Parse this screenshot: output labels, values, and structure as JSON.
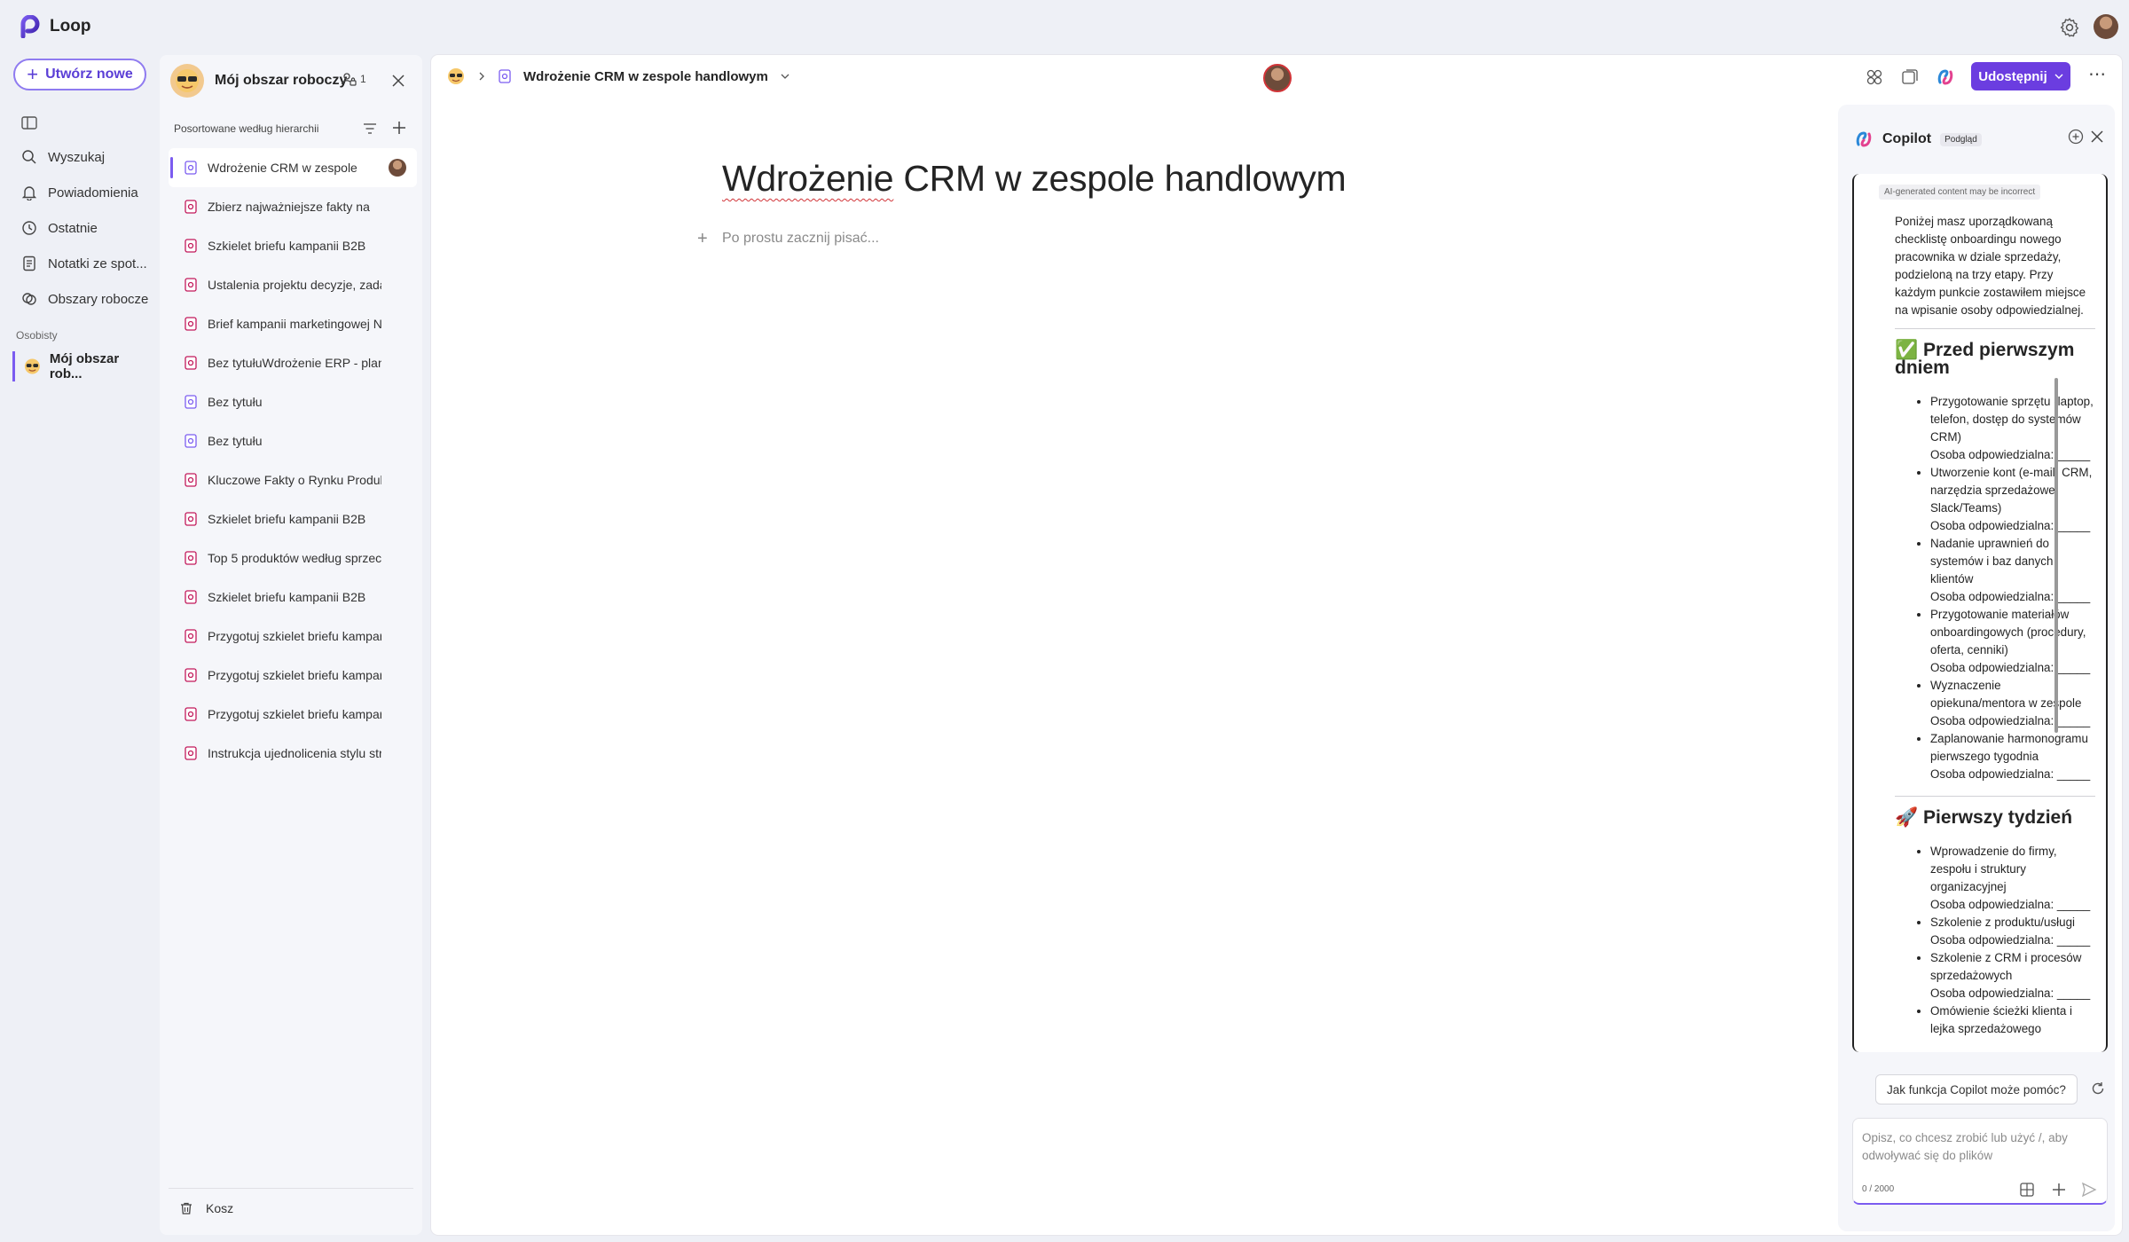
{
  "app": {
    "name": "Loop"
  },
  "nav": {
    "create_label": "Utwórz nowe",
    "items": [
      {
        "label": "Wyszukaj",
        "icon": "search-icon"
      },
      {
        "label": "Powiadomienia",
        "icon": "bell-icon"
      },
      {
        "label": "Ostatnie",
        "icon": "clock-icon"
      },
      {
        "label": "Notatki ze spot...",
        "icon": "notes-icon"
      },
      {
        "label": "Obszary robocze",
        "icon": "workspaces-icon"
      }
    ],
    "section_label": "Osobisty",
    "workspace_label": "Mój obszar rob..."
  },
  "workspace": {
    "title": "Mój obszar roboczy",
    "member_count": "1",
    "sort_label": "Posortowane według hierarchii",
    "pages": [
      "Wdrożenie CRM w zespole",
      "Zbierz najważniejsze fakty na",
      "Szkielet briefu kampanii B2B",
      "Ustalenia projektu decyzje, zada",
      "Brief kampanii marketingowej N",
      "Bez tytułuWdrożenie ERP - plan",
      "Bez tytułu",
      "Bez tytułu",
      "Kluczowe Fakty o Rynku Produk",
      "Szkielet briefu kampanii B2B",
      "Top 5 produktów według sprzec",
      "Szkielet briefu kampanii B2B",
      "Przygotuj szkielet briefu kampar",
      "Przygotuj szkielet briefu kampar",
      "Przygotuj szkielet briefu kampar",
      "Instrukcja ujednolicenia stylu str"
    ],
    "trash_label": "Kosz"
  },
  "doc": {
    "breadcrumb_title": "Wdrożenie CRM w zespole handlowym",
    "title_word1": "Wdrożenie",
    "title_rest": " CRM w zespole handlowym",
    "placeholder": "Po prostu zacznij pisać...",
    "share_label": "Udostępnij"
  },
  "copilot": {
    "title": "Copilot",
    "badge": "Podgląd",
    "disclaimer": "AI-generated content may be incorrect",
    "intro": "Poniżej masz uporządkowaną checklistę onboardingu nowego pracownika w dziale sprzedaży, podzieloną na trzy etapy. Przy każdym punkcie zostawiłem miejsce na wpisanie osoby odpowiedzialnej.",
    "sections": [
      {
        "heading": "✅ Przed pierwszym dniem",
        "items": [
          "Przygotowanie sprzętu (laptop, telefon, dostęp do systemów CRM)",
          "Utworzenie kont (e-mail, CRM, narzędzia sprzedażowe, Slack/Teams)",
          "Nadanie uprawnień do systemów i baz danych klientów",
          "Przygotowanie materiałów onboardingowych (procedury, oferta, cenniki)",
          "Wyznaczenie opiekuna/mentora w zespole",
          "Zaplanowanie harmonogramu pierwszego tygodnia"
        ]
      },
      {
        "heading": "🚀 Pierwszy tydzień",
        "items": [
          "Wprowadzenie do firmy, zespołu i struktury organizacyjnej",
          "Szkolenie z produktu/usługi",
          "Szkolenie z CRM i procesów sprzedażowych",
          "Omówienie ścieżki klienta i lejka sprzedażowego"
        ]
      }
    ],
    "owner_line": "Osoba odpowiedzialna: _____",
    "suggestion": "Jak funkcja Copilot może pomóc?",
    "input_placeholder": "Opisz, co chcesz zrobić lub użyć /, aby odwoływać się do plików",
    "char_count": "0 / 2000"
  }
}
